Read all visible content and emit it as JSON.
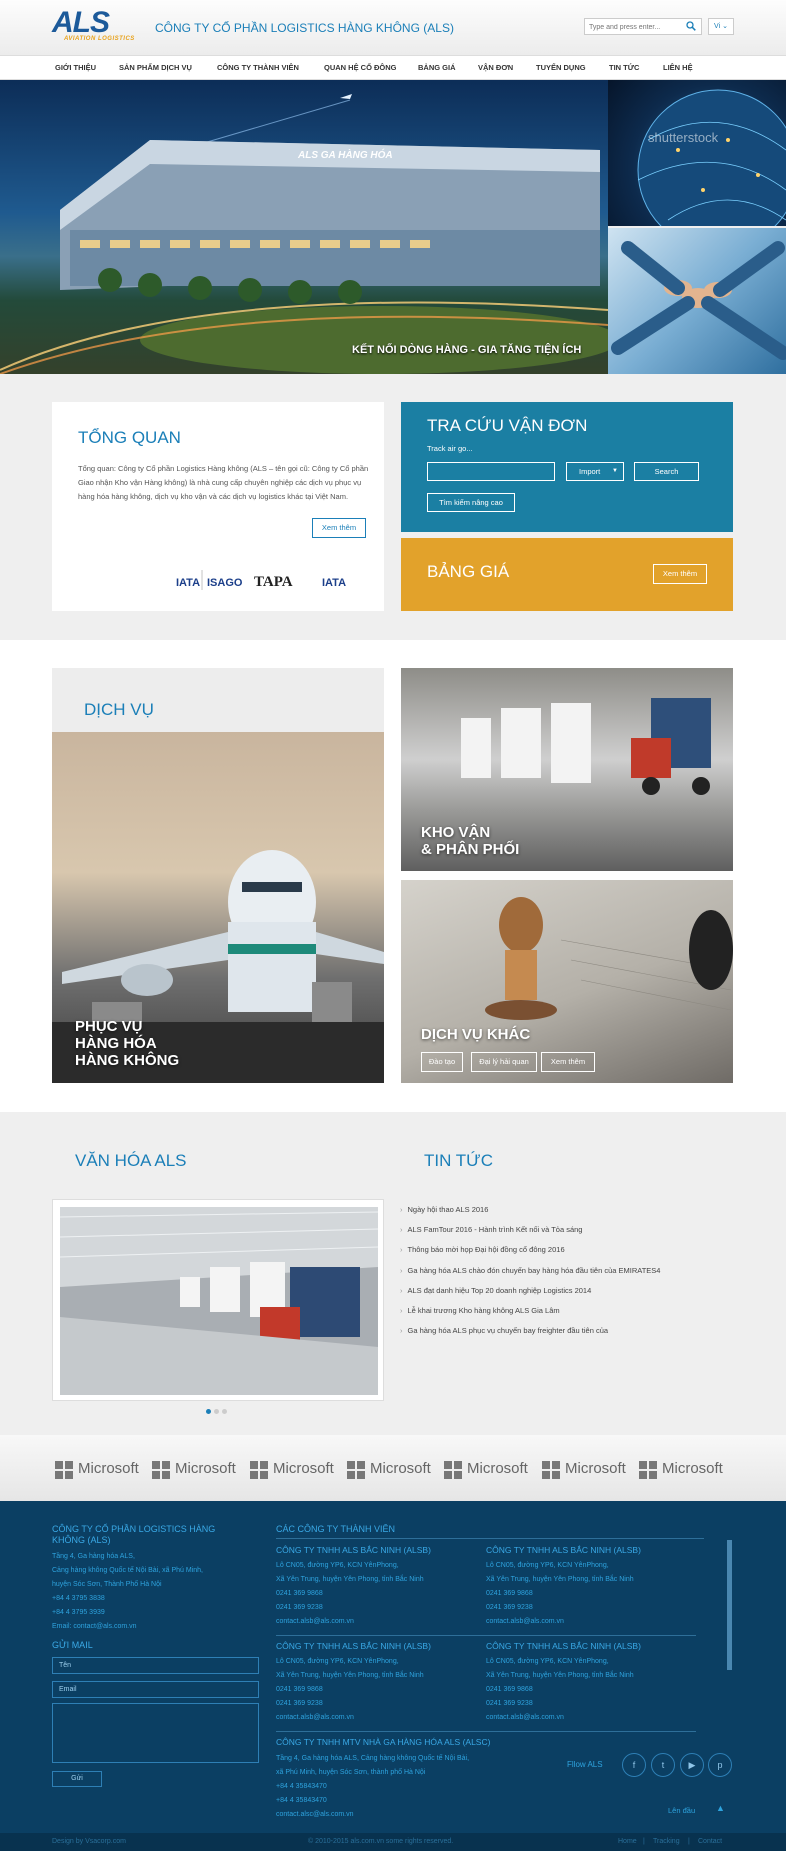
{
  "header": {
    "logo_text": "ALS",
    "logo_sub": "AVIATION LOGISTICS",
    "company_title": "CÔNG TY CỔ PHẦN LOGISTICS HÀNG KHÔNG (ALS)",
    "search_placeholder": "Type and press enter...",
    "lang": "Vi ⌄"
  },
  "nav": [
    "GIỚI THIỆU",
    "SẢN PHẨM DỊCH VỤ",
    "CÔNG TY THÀNH VIÊN",
    "QUAN HỆ CỔ ĐÔNG",
    "BẢNG GIÁ",
    "VẬN ĐƠN",
    "TUYỂN DỤNG",
    "TIN TỨC",
    "LIÊN HỆ"
  ],
  "hero": {
    "caption": "KẾT NỐI DÒNG HÀNG - GIA TĂNG TIỆN ÍCH",
    "building_sign": "ALS GA HÀNG HÓA",
    "watermark": "shutterstock"
  },
  "overview": {
    "title": "TỔNG QUAN",
    "text": "Tổng quan: Công ty Cổ phần Logistics Hàng không (ALS – tên gọi cũ: Công ty Cổ phần Giao nhận Kho vận Hàng không) là nhà cung cấp chuyên nghiệp các dịch vụ phục vụ hàng hóa hàng không, dịch vụ kho vận và các dịch vụ logistics khác tại Việt Nam.",
    "more": "Xem thêm",
    "certs": [
      "IATA",
      "ISAGO",
      "TAPA",
      "IATA"
    ]
  },
  "tracking": {
    "title": "TRA CỨU VẬN ĐƠN",
    "label": "Track air go...",
    "select": "Import",
    "search": "Search",
    "advanced": "Tìm kiếm nâng cao"
  },
  "pricing": {
    "title": "BẢNG GIÁ",
    "more": "Xem thêm"
  },
  "services": {
    "title": "DỊCH VỤ",
    "cargo": [
      "PHỤC VỤ",
      "HÀNG HÓA",
      "HÀNG KHÔNG"
    ],
    "warehouse": [
      "KHO VẬN",
      "& PHÂN PHỐI"
    ],
    "other": "DỊCH VỤ KHÁC",
    "tags": [
      "Đào tạo",
      "Đại lý hải quan",
      "Xem thêm"
    ]
  },
  "culture": {
    "title": "VĂN HÓA ALS"
  },
  "news": {
    "title": "TIN TỨC",
    "items": [
      "Ngày hội thao ALS 2016",
      "ALS FamTour 2016 - Hành trình Kết nối và Tỏa sáng",
      "Thông báo mời họp Đại hội đồng cổ đông 2016",
      "Ga hàng hóa ALS chào đón chuyến bay hàng hóa đầu tiên của EMIRATES4",
      "ALS đạt danh hiệu Top 20 doanh nghiệp Logistics 2014",
      "Lễ khai trương Kho hàng không ALS Gia Lâm",
      "Ga hàng hóa ALS phục vụ chuyến bay freighter đầu tiên của"
    ]
  },
  "partners": [
    "Microsoft",
    "Microsoft",
    "Microsoft",
    "Microsoft",
    "Microsoft",
    "Microsoft",
    "Microsoft"
  ],
  "colors": {
    "brand_blue": "#1b7fb8",
    "track_blue": "#1b7fa3",
    "price_orange": "#e2a22b",
    "footer_bg": "#0b3f63"
  },
  "footer": {
    "company": [
      "CÔNG TY CỔ PHẦN LOGISTICS HÀNG",
      "KHÔNG (ALS)"
    ],
    "address": [
      "Tầng 4, Ga hàng hóa ALS,",
      "Cảng hàng không Quốc tế Nội Bài, xã Phú Minh,",
      "huyện Sóc Sơn, Thành Phố Hà Nội",
      "+84 4 3795 3838",
      "+84 4 3795 3939",
      "Email: contact@als.com.vn"
    ],
    "mail_title": "GỬI MAIL",
    "name_ph": "Tên",
    "email_ph": "Email",
    "send": "Gửi",
    "members_title": "CÁC CÔNG TY THÀNH VIÊN",
    "members": [
      {
        "name": "CÔNG TY TNHH ALS BẮC NINH (ALSB)",
        "lines": [
          "Lô CN05, đường YP6, KCN YênPhong,",
          "Xã Yên Trung, huyện Yên Phong, tỉnh Bắc Ninh",
          "0241 369 9868",
          "0241 369 9238",
          "contact.alsb@als.com.vn"
        ]
      },
      {
        "name": "CÔNG TY TNHH ALS BẮC NINH (ALSB)",
        "lines": [
          "Lô CN05, đường YP6, KCN YênPhong,",
          "Xã Yên Trung, huyện Yên Phong, tỉnh Bắc Ninh",
          "0241 369 9868",
          "0241 369 9238",
          "contact.alsb@als.com.vn"
        ]
      },
      {
        "name": "CÔNG TY TNHH ALS BẮC NINH (ALSB)",
        "lines": [
          "Lô CN05, đường YP6, KCN YênPhong,",
          "Xã Yên Trung, huyện Yên Phong, tỉnh Bắc Ninh",
          "0241 369 9868",
          "0241 369 9238",
          "contact.alsb@als.com.vn"
        ]
      },
      {
        "name": "CÔNG TY TNHH ALS BẮC NINH (ALSB)",
        "lines": [
          "Lô CN05, đường YP6, KCN YênPhong,",
          "Xã Yên Trung, huyện Yên Phong, tỉnh Bắc Ninh",
          "0241 369 9868",
          "0241 369 9238",
          "contact.alsb@als.com.vn"
        ]
      },
      {
        "name": "CÔNG TY TNHH MTV NHÀ GA HÀNG HÓA ALS (ALSC)",
        "lines": [
          "Tầng 4, Ga hàng hóa ALS, Cảng hàng không Quốc tế Nội Bài,",
          "xã Phú Minh, huyện Sóc Sơn, thành phố Hà Nội",
          "+84 4 35843470",
          "+84 4 35843470",
          "contact.alsc@als.com.vn"
        ]
      }
    ],
    "follow": "Fllow ALS",
    "social": [
      "f",
      "t",
      "▶",
      "p"
    ],
    "top": "Lên đầu",
    "design": "Design by Vsacorp.com",
    "copyright": "© 2010-2015 als.com.vn some rights reserved.",
    "links": [
      "Home",
      "Tracking",
      "Contact"
    ]
  }
}
